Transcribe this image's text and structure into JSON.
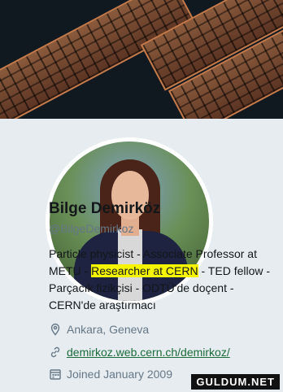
{
  "profile": {
    "name": "Bilge Demirköz",
    "handle": "@BilgeDemirkoz",
    "bio": {
      "line1": "Particle physicist - Associate Professor at",
      "line2_a": "METU - ",
      "line2_highlight": "Researcher at CERN",
      "line2_b": " - TED fellow -",
      "line3": "Parçacık fizikçisi - ODTÜ'de doçent -",
      "line4": "CERN'de araştırmacı"
    },
    "location": "Ankara, Geneva",
    "website": "demirkoz.web.cern.ch/demirkoz/",
    "joined": "Joined January 2009"
  },
  "icons": {
    "location": "location-pin-icon",
    "website": "link-icon",
    "joined": "calendar-icon"
  },
  "watermark": "GULDUM.NET",
  "colors": {
    "background": "#e6ecf0",
    "highlight": "#f5f500",
    "link": "#1b6b3a",
    "secondary_text": "#657786"
  }
}
